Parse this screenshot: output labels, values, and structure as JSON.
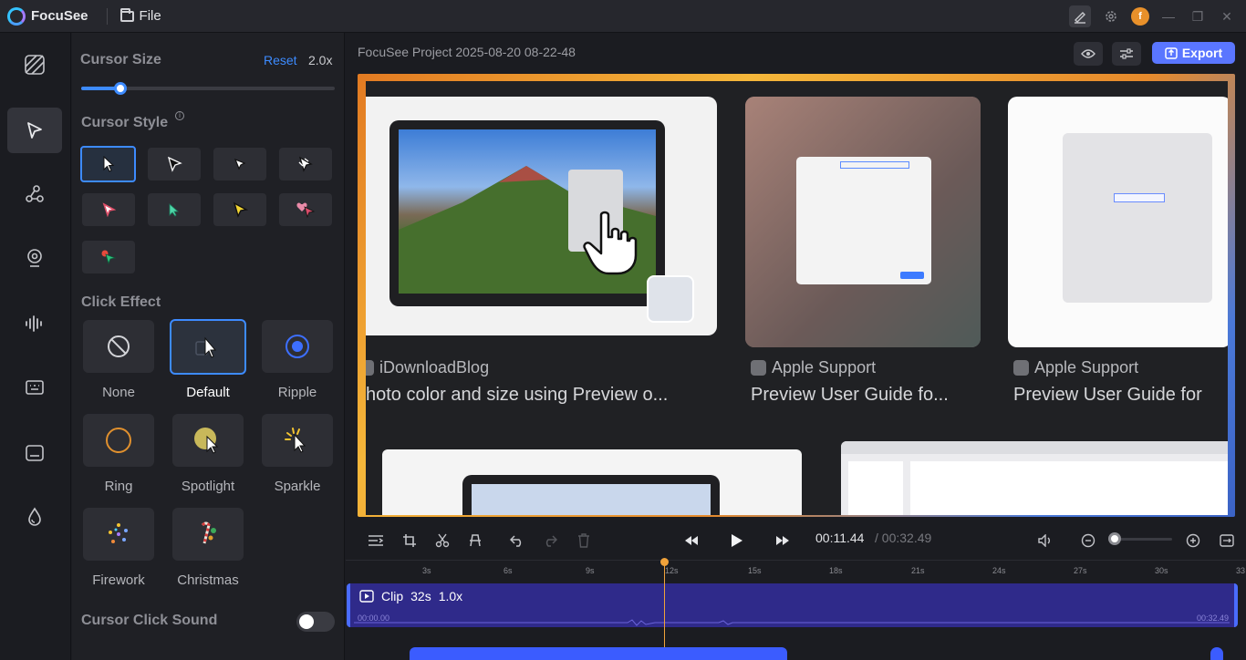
{
  "app": {
    "name": "FocuSee",
    "file_menu": "File"
  },
  "panel": {
    "cursor_size": {
      "title": "Cursor Size",
      "reset": "Reset",
      "value": "2.0x",
      "slider_fraction": 0.15
    },
    "cursor_style": {
      "title": "Cursor Style",
      "info": "i",
      "selected_index": 0
    },
    "click_effect": {
      "title": "Click Effect",
      "items": [
        {
          "label": "None",
          "icon": "prohibited-icon"
        },
        {
          "label": "Default",
          "icon": "cursor-default-icon"
        },
        {
          "label": "Ripple",
          "icon": "ripple-icon"
        },
        {
          "label": "Ring",
          "icon": "ring-icon"
        },
        {
          "label": "Spotlight",
          "icon": "spotlight-icon"
        },
        {
          "label": "Sparkle",
          "icon": "sparkle-icon"
        },
        {
          "label": "Firework",
          "icon": "firework-icon"
        },
        {
          "label": "Christmas",
          "icon": "christmas-icon"
        }
      ],
      "selected": "Default"
    },
    "click_sound": {
      "title": "Cursor Click Sound",
      "enabled": false
    }
  },
  "header": {
    "project_title": "FocuSee Project 2025-08-20 08-22-48",
    "export_label": "Export"
  },
  "preview": {
    "results": [
      {
        "source": "iDownloadBlog",
        "title": "hoto color and size using Preview o..."
      },
      {
        "source": "Apple Support",
        "title": "Preview User Guide fo..."
      },
      {
        "source": "Apple Support",
        "title": "Preview User Guide for"
      }
    ]
  },
  "transport": {
    "current_time": "00:11.44",
    "separator": "/",
    "total_time": "00:32.49"
  },
  "timeline": {
    "ticks": [
      "3s",
      "6s",
      "9s",
      "12s",
      "15s",
      "18s",
      "21s",
      "24s",
      "27s",
      "30s",
      "33"
    ],
    "clip": {
      "label": "Clip",
      "duration": "32s",
      "speed": "1.0x",
      "start": "00:00.00",
      "end": "00:32.49"
    }
  },
  "colors": {
    "accent": "#3d8bff",
    "export": "#5a76ff",
    "playhead": "#f0a23a",
    "clip": "#2f2a8a"
  }
}
